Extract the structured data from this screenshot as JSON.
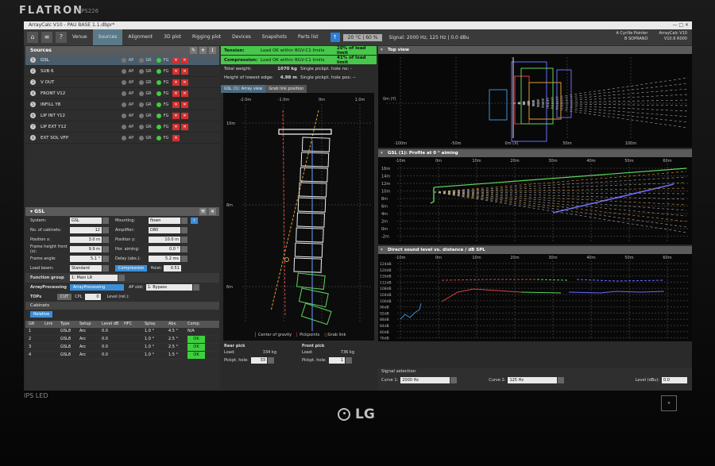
{
  "monitor": {
    "brand": "FLATRON",
    "model": "IPS226",
    "logo": "LG",
    "panel": "IPS LED"
  },
  "window": {
    "title": "ArrayCalc V10 - PAU BASE 1.1.dbpr*",
    "controls": "—  □  ✕"
  },
  "toolbar": {
    "tabs": [
      "Venue",
      "Sources",
      "Alignment",
      "3D plot",
      "Rigging plot",
      "Devices",
      "Snapshots",
      "Parts list"
    ],
    "active_tab": "Sources",
    "temperature": "20 °C | 60 %",
    "signal": "Signal: 2000 Hz, 125 Hz | 0.0 dBu",
    "user_line1": "A Cyrille Pointer",
    "user_line2": "B SOPRANO",
    "version_line1": "ArrayCalc V10",
    "version_line2": "V10.6 R000"
  },
  "sources": {
    "header": "Sources",
    "items": [
      {
        "num": "1",
        "name": "GSL",
        "selected": true,
        "fg": true,
        "red": 2
      },
      {
        "num": "2",
        "name": "SUB 6",
        "selected": false,
        "fg": true,
        "red": 2
      },
      {
        "num": "3",
        "name": "V OUT",
        "selected": false,
        "fg": true,
        "red": 2
      },
      {
        "num": "4",
        "name": "FRONT V12",
        "selected": false,
        "fg": true,
        "red": 2
      },
      {
        "num": "5",
        "name": "INFILL Y8",
        "selected": false,
        "fg": true,
        "red": 2
      },
      {
        "num": "6",
        "name": "LIP INT Y12",
        "selected": false,
        "fg": true,
        "red": 2
      },
      {
        "num": "7",
        "name": "LIP EXT Y12",
        "selected": false,
        "fg": true,
        "red": 2
      },
      {
        "num": "8",
        "name": "EXT SOL VFP",
        "selected": false,
        "fg": true,
        "red": 1
      }
    ],
    "col_ap": "AP",
    "col_gr": "GR",
    "col_fg": "FG"
  },
  "properties": {
    "header": "GSL",
    "system_label": "System:",
    "system": "GSL",
    "mounting_label": "Mounting:",
    "mounting": "flown",
    "cabinets_label": "No. of cabinets:",
    "cabinets": "12",
    "amplifier_label": "Amplifier:",
    "amplifier": "D80",
    "pos_x_label": "Position x:",
    "pos_x": "3.0 m",
    "pos_y_label": "Position y:",
    "pos_y": "10.0 m",
    "frame_height_label": "Frame height front (z):",
    "frame_height": "9.9 m",
    "hor_aiming_label": "Hor. aiming:",
    "hor_aiming": "0.0 °",
    "frame_angle_label": "Frame angle:",
    "frame_angle": "5.1 °",
    "delay_label": "Delay (abs.):",
    "delay": "5.2 ms",
    "load_beam_label": "Load beam:",
    "load_beam": "Standard",
    "compression_label": "Compression",
    "hoist_label": "Hoist:",
    "hoist": "0.51",
    "function_group_label": "Function group",
    "function_group": "1: Main LR",
    "array_processing_label": "ArrayProcessing",
    "array_processing": "ArrayProcessing",
    "ap_slot_label": "AP slot:",
    "ap_slot": "1: Bypass",
    "tops_label": "TOPs",
    "cut_label": "CUT",
    "cpl_label": "CPL",
    "cpl": "0",
    "level_label": "Level (rel.):",
    "cabinets_section": "Cabinets",
    "relative_label": "Relative"
  },
  "cabinet_table": {
    "headers": [
      "GR",
      "Link",
      "Type",
      "Setup",
      "Level dB",
      "HFC",
      "Splay",
      "Abs.",
      "Comp."
    ],
    "rows": [
      [
        "1",
        "",
        "GSL8",
        "Arc",
        "0.0",
        "",
        "1.0 °",
        "4.5 °",
        "N/A"
      ],
      [
        "2",
        "",
        "GSL8",
        "Arc",
        "0.0",
        "",
        "1.0 °",
        "2.5 °",
        "OK"
      ],
      [
        "3",
        "",
        "GSL8",
        "Arc",
        "0.0",
        "",
        "1.0 °",
        "2.5 °",
        "OK"
      ],
      [
        "4",
        "",
        "GSL8",
        "Arc",
        "0.0",
        "",
        "1.0 °",
        "1.5 °",
        "OK"
      ]
    ]
  },
  "load_status": {
    "tension_label": "Tension:",
    "tension_text": "Load OK within BGV-C1 limits",
    "tension_pct": "20% of load limit",
    "compression_label": "Compression:",
    "compression_text": "Load OK within BGV-C1 limits",
    "compression_pct": "41% of load limit",
    "total_weight_label": "Total weight:",
    "total_weight": "1070 kg",
    "total_weight_note": "Single pickpt. hole no: -",
    "lowest_edge_label": "Height of lowest edge:",
    "lowest_edge": "4.98 m",
    "lowest_edge_note": "Single pickpt. hole pos: --"
  },
  "array_view": {
    "tabs": [
      "GSL (1): Array view",
      "Grab link position"
    ],
    "x_ticks": [
      "-2.0m",
      "-1.0m",
      "0m",
      "1.0m"
    ],
    "y_ticks": [
      "10m",
      "8m",
      "6m"
    ],
    "legend": [
      "Center of gravity",
      "Pickpoints",
      "Grab link"
    ]
  },
  "picks": {
    "rear_title": "Rear pick",
    "rear_load_label": "Load:",
    "rear_load": "334 kg",
    "rear_hole_label": "Pickpt. hole:",
    "rear_hole": "33",
    "front_title": "Front pick",
    "front_load_label": "Load:",
    "front_load": "736 kg",
    "front_hole_label": "Pickpt. hole:",
    "front_hole": "1"
  },
  "top_view": {
    "title": "Top view",
    "x_ticks": [
      "-100m",
      "-50m",
      "0m (X)",
      "50m",
      "100m"
    ],
    "y_label": "0m (Y)"
  },
  "profile": {
    "title": "GSL (1): Profile at 0 ° aiming",
    "x_ticks": [
      "-10m",
      "0m",
      "10m",
      "20m",
      "30m",
      "40m",
      "50m",
      "60m"
    ],
    "y_ticks": [
      "16m",
      "14m",
      "12m",
      "10m",
      "8m",
      "6m",
      "4m",
      "2m",
      "0m",
      "-2m"
    ]
  },
  "spl": {
    "title": "Direct sound level vs. distance / dB SPL",
    "x_ticks": [
      "-10m",
      "0m",
      "10m",
      "20m",
      "30m",
      "40m",
      "50m",
      "60m"
    ],
    "y_ticks": [
      "124dB",
      "120dB",
      "116dB",
      "112dB",
      "108dB",
      "104dB",
      "100dB",
      "96dB",
      "92dB",
      "88dB",
      "84dB",
      "80dB",
      "76dB"
    ]
  },
  "signal_selection": {
    "title": "Signal selection",
    "curve1_label": "Curve 1:",
    "curve1": "2000 Hz",
    "curve2_label": "Curve 2:",
    "curve2": "125 Hz",
    "level_label": "Level (dBu):",
    "level": "0.0"
  }
}
